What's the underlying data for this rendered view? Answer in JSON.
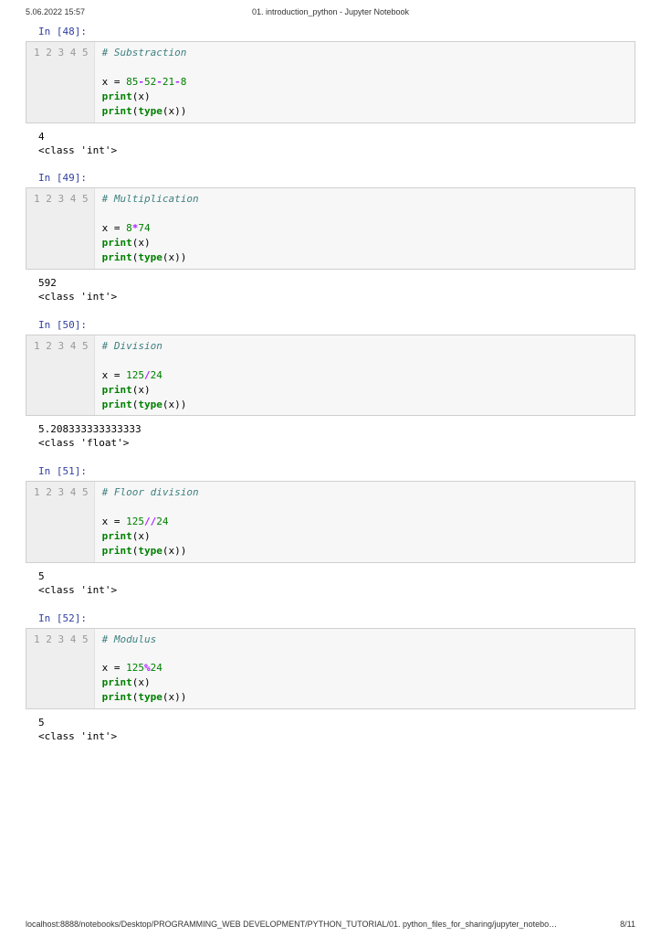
{
  "header": {
    "left": "5.06.2022 15:57",
    "center": "01. introduction_python - Jupyter Notebook"
  },
  "footer": {
    "path": "localhost:8888/notebooks/Desktop/PROGRAMMING_WEB DEVELOPMENT/PYTHON_TUTORIAL/01. python_files_for_sharing/jupyter_notebo…",
    "page": "8/11"
  },
  "cells": [
    {
      "prompt": "In [48]:",
      "lines": [
        "1",
        "2",
        "3",
        "4",
        "5"
      ],
      "comment": "# Substraction",
      "assign_prefix": "x = ",
      "tokens": [
        {
          "t": "85",
          "c": "nm"
        },
        {
          "t": "-",
          "c": "op"
        },
        {
          "t": "52",
          "c": "nm"
        },
        {
          "t": "-",
          "c": "op"
        },
        {
          "t": "21",
          "c": "nm"
        },
        {
          "t": "-",
          "c": "op"
        },
        {
          "t": "8",
          "c": "nm"
        }
      ],
      "print1": {
        "kw": "print",
        "arg": "x"
      },
      "print2": {
        "kw": "print",
        "inner": "type",
        "arg": "x"
      },
      "output": "4\n<class 'int'>"
    },
    {
      "prompt": "In [49]:",
      "lines": [
        "1",
        "2",
        "3",
        "4",
        "5"
      ],
      "comment": "# Multiplication",
      "assign_prefix": "x = ",
      "tokens": [
        {
          "t": "8",
          "c": "nm"
        },
        {
          "t": "*",
          "c": "op"
        },
        {
          "t": "74",
          "c": "nm"
        }
      ],
      "print1": {
        "kw": "print",
        "arg": "x"
      },
      "print2": {
        "kw": "print",
        "inner": "type",
        "arg": "x"
      },
      "output": "592\n<class 'int'>"
    },
    {
      "prompt": "In [50]:",
      "lines": [
        "1",
        "2",
        "3",
        "4",
        "5"
      ],
      "comment": "# Division",
      "assign_prefix": "x = ",
      "tokens": [
        {
          "t": "125",
          "c": "nm"
        },
        {
          "t": "/",
          "c": "op"
        },
        {
          "t": "24",
          "c": "nm"
        }
      ],
      "print1": {
        "kw": "print",
        "arg": "x"
      },
      "print2": {
        "kw": "print",
        "inner": "type",
        "arg": "x"
      },
      "output": "5.208333333333333\n<class 'float'>"
    },
    {
      "prompt": "In [51]:",
      "lines": [
        "1",
        "2",
        "3",
        "4",
        "5"
      ],
      "comment": "# Floor division",
      "assign_prefix": "x = ",
      "tokens": [
        {
          "t": "125",
          "c": "nm"
        },
        {
          "t": "//",
          "c": "op"
        },
        {
          "t": "24",
          "c": "nm"
        }
      ],
      "print1": {
        "kw": "print",
        "arg": "x"
      },
      "print2": {
        "kw": "print",
        "inner": "type",
        "arg": "x"
      },
      "output": "5\n<class 'int'>"
    },
    {
      "prompt": "In [52]:",
      "lines": [
        "1",
        "2",
        "3",
        "4",
        "5"
      ],
      "comment": "# Modulus",
      "assign_prefix": "x = ",
      "tokens": [
        {
          "t": "125",
          "c": "nm"
        },
        {
          "t": "%",
          "c": "op"
        },
        {
          "t": "24",
          "c": "nm"
        }
      ],
      "print1": {
        "kw": "print",
        "arg": "x"
      },
      "print2": {
        "kw": "print",
        "inner": "type",
        "arg": "x"
      },
      "output": "5\n<class 'int'>"
    }
  ]
}
